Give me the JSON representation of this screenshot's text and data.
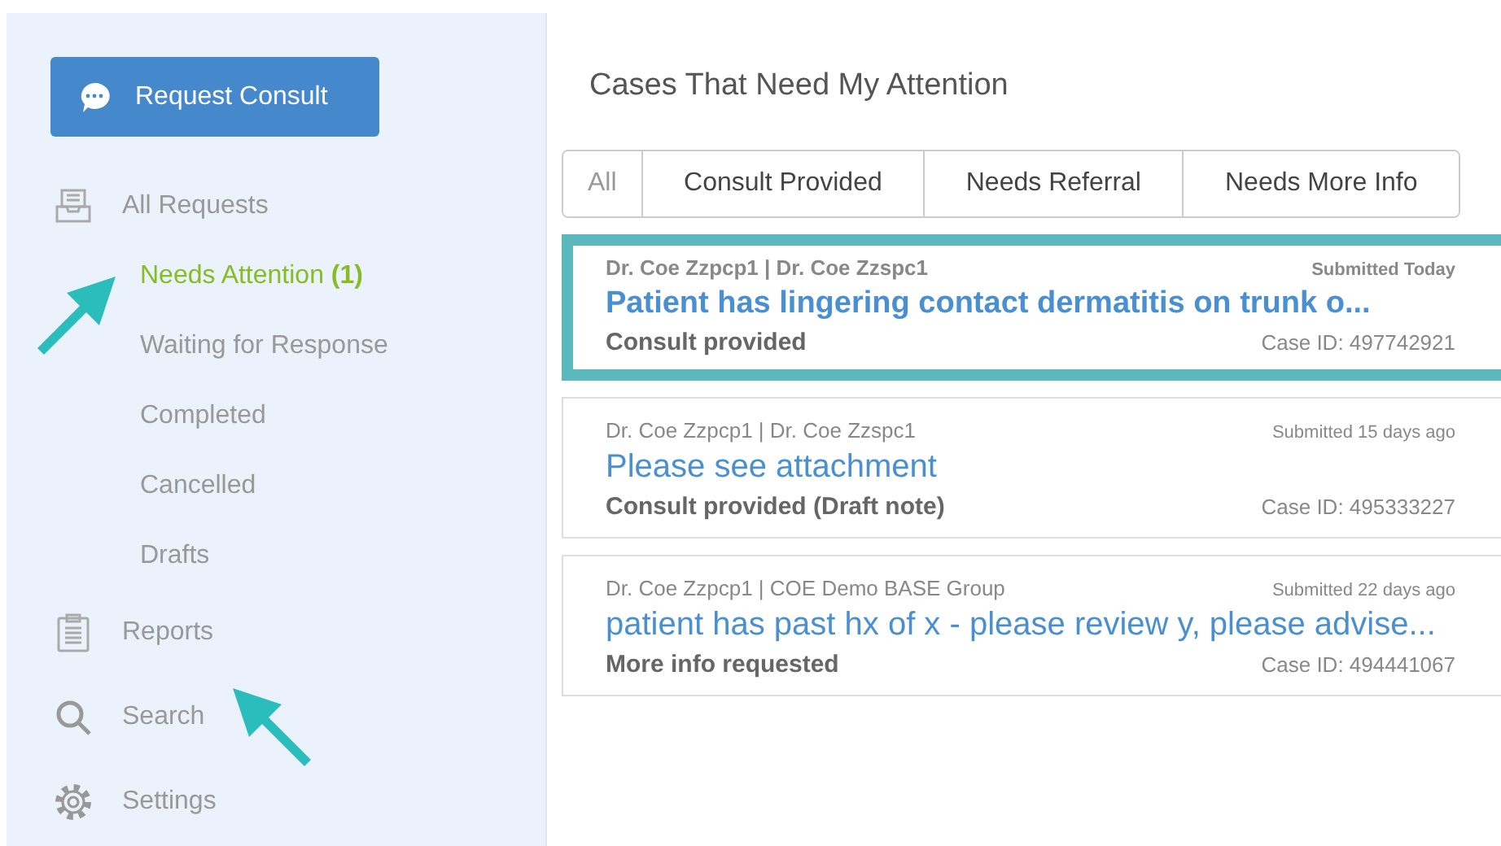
{
  "sidebar": {
    "request_button": "Request Consult",
    "items": [
      {
        "kind": "inbox",
        "label": "All Requests",
        "selected": false,
        "arrow": false,
        "children": [
          {
            "label": "Needs Attention **(1)**",
            "selected": true,
            "arrow": true
          },
          {
            "label": "Waiting for Response",
            "selected": false,
            "arrow": false
          },
          {
            "label": "Completed",
            "selected": false,
            "arrow": false
          },
          {
            "label": "Cancelled",
            "selected": false,
            "arrow": false
          },
          {
            "label": "Drafts",
            "selected": false,
            "arrow": false
          }
        ]
      },
      {
        "kind": "clipboard",
        "label": "Reports",
        "selected": false,
        "arrow": false
      },
      {
        "kind": "search",
        "label": "Search",
        "selected": false,
        "arrow": true
      },
      {
        "kind": "gear",
        "label": "Settings",
        "selected": false,
        "arrow": false
      }
    ]
  },
  "main": {
    "title": "Cases That Need My Attention",
    "tabs": [
      {
        "label": "All",
        "selected": true
      },
      {
        "label": "Consult Provided",
        "selected": false
      },
      {
        "label": "Needs Referral",
        "selected": false
      },
      {
        "label": "Needs More Info",
        "selected": false
      }
    ],
    "cases": [
      {
        "parties": "Dr. Coe Zzpcp1 | Dr. Coe Zzspc1",
        "submitted": "Submitted Today",
        "subject": "Patient has lingering contact dermatitis on trunk o...",
        "status": "Consult provided",
        "case_id": "Case ID: 497742921",
        "highlighted": true,
        "unread": true
      },
      {
        "parties": "Dr. Coe Zzpcp1 | Dr. Coe Zzspc1",
        "submitted": "Submitted 15 days ago",
        "subject": "Please see attachment",
        "status": "Consult provided (Draft note)",
        "case_id": "Case ID: 495333227",
        "highlighted": false,
        "unread": false
      },
      {
        "parties": "Dr. Coe Zzpcp1 | COE Demo BASE Group",
        "submitted": "Submitted 22 days ago",
        "subject": "patient has past hx of x - please review y, please advise...",
        "status": "More info requested",
        "case_id": "Case ID: 494441067",
        "highlighted": false,
        "unread": false
      }
    ]
  }
}
